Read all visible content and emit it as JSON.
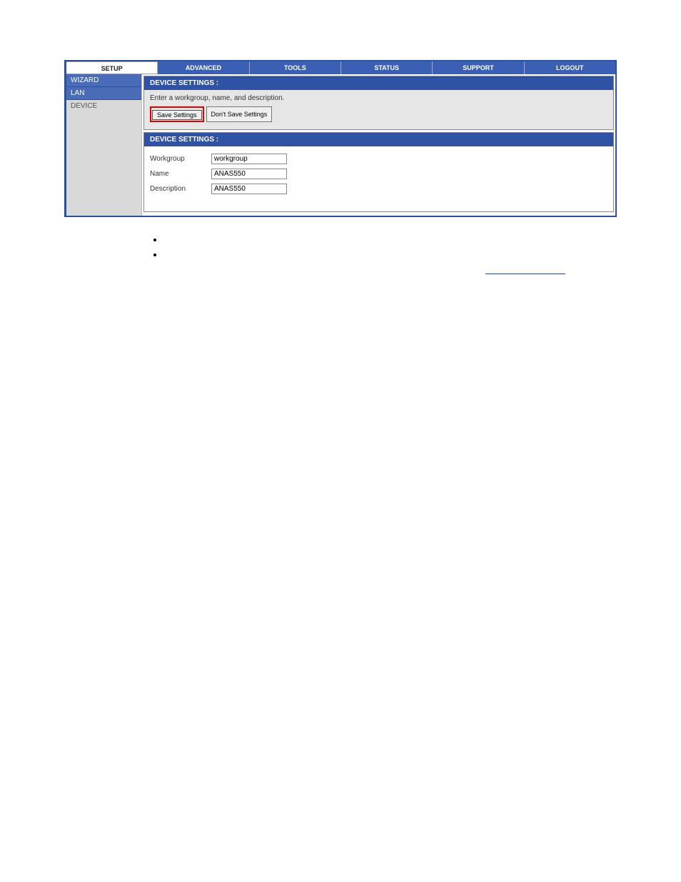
{
  "topnav": {
    "tabs": [
      {
        "label": "SETUP",
        "active": true
      },
      {
        "label": "ADVANCED",
        "active": false
      },
      {
        "label": "TOOLS",
        "active": false
      },
      {
        "label": "STATUS",
        "active": false
      },
      {
        "label": "SUPPORT",
        "active": false
      },
      {
        "label": "LOGOUT",
        "active": false
      }
    ]
  },
  "sidebar": {
    "items": [
      {
        "label": "WIZARD",
        "style": "blue"
      },
      {
        "label": "LAN",
        "style": "blue"
      },
      {
        "label": "DEVICE",
        "style": "gray"
      }
    ]
  },
  "panel1": {
    "title": "DEVICE SETTINGS :",
    "description": "Enter a workgroup, name, and description.",
    "buttons": {
      "save": "Save Settings",
      "dont_save": "Don't Save Settings"
    }
  },
  "panel2": {
    "title": "DEVICE SETTINGS :",
    "fields": {
      "workgroup_label": "Workgroup",
      "workgroup_value": "workgroup",
      "name_label": "Name",
      "name_value": "ANAS550",
      "description_label": "Description",
      "description_value": "ANAS550"
    }
  }
}
